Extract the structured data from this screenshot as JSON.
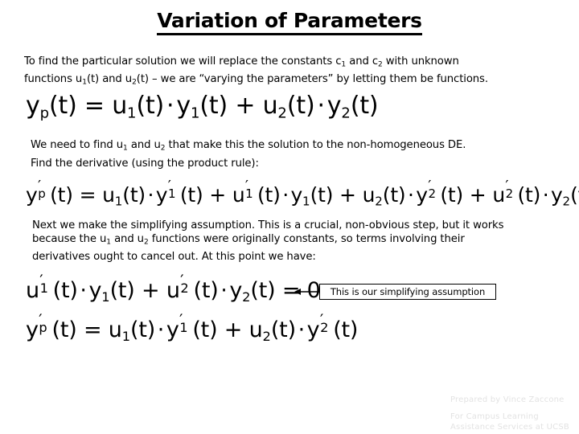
{
  "slide": {
    "title": "Variation of Parameters"
  },
  "body": {
    "intro_line1_a": "To find the particular solution we will replace the constants c",
    "intro_line1_sub1": "1",
    "intro_line1_b": " and c",
    "intro_line1_sub2": "2",
    "intro_line1_c": " with unknown",
    "intro_line2_a": "functions u",
    "intro_line2_sub1": "1",
    "intro_line2_b": "(t) and u",
    "intro_line2_sub2": "2",
    "intro_line2_c": "(t) – we are “varying the parameters” by letting them be functions.",
    "need_a": "We need to find u",
    "need_sub1": "1",
    "need_b": " and u",
    "need_sub2": "2",
    "need_c": " that make this the solution to the non-homogeneous DE.",
    "derivative_line": "Find the derivative (using the product rule):",
    "next_line1": "Next we make the simplifying assumption. This is a crucial, non-obvious step, but it works",
    "next_line2_a": "because the u",
    "next_line2_sub1": "1",
    "next_line2_b": " and u",
    "next_line2_sub2": "2",
    "next_line2_c": " functions were originally constants, so terms involving their",
    "next_line3": "derivatives ought to cancel out.  At this point we have:"
  },
  "equations": {
    "yp": {
      "lhs_var": "y",
      "lhs_sub": "p",
      "lhs_arg": "(t) = ",
      "t1_var": "u",
      "t1_sub": "1",
      "t1_arg": "(t)",
      "dot": "·",
      "t2_var": "y",
      "t2_sub": "1",
      "t2_arg": "(t)",
      "plus": " + ",
      "t3_var": "u",
      "t3_sub": "2",
      "t3_arg": "(t)",
      "t4_var": "y",
      "t4_sub": "2",
      "t4_arg": "(t)"
    },
    "yp_prime": {
      "lhs_var": "y",
      "lhs_prime": "′",
      "lhs_sub": "p",
      "lhs_arg": "(t) = ",
      "a_var": "u",
      "a_sub": "1",
      "a_arg": "(t)",
      "b_var": "y",
      "b_prime": "′",
      "b_sub": "1",
      "b_arg": "(t)",
      "c_var": "u",
      "c_prime": "′",
      "c_sub": "1",
      "c_arg": "(t)",
      "d_var": "y",
      "d_sub": "1",
      "d_arg": "(t)",
      "e_var": "u",
      "e_sub": "2",
      "e_arg": "(t)",
      "f_var": "y",
      "f_prime": "′",
      "f_sub": "2",
      "f_arg": "(t)",
      "g_var": "u",
      "g_prime": "′",
      "g_sub": "2",
      "g_arg": "(t)",
      "h_var": "y",
      "h_sub": "2",
      "h_arg": "(t)",
      "dot": "·",
      "plus": " + "
    },
    "assumption": {
      "a_var": "u",
      "a_prime": "′",
      "a_sub": "1",
      "a_arg": "(t)",
      "b_var": "y",
      "b_sub": "1",
      "b_arg": "(t)",
      "c_var": "u",
      "c_prime": "′",
      "c_sub": "2",
      "c_arg": "(t)",
      "d_var": "y",
      "d_sub": "2",
      "d_arg": "(t)",
      "dot": "·",
      "plus": " + ",
      "rhs": " = 0"
    },
    "final": {
      "lhs_var": "y",
      "lhs_prime": "′",
      "lhs_sub": "p",
      "lhs_arg": "(t) = ",
      "a_var": "u",
      "a_sub": "1",
      "a_arg": "(t)",
      "b_var": "y",
      "b_prime": "′",
      "b_sub": "1",
      "b_arg": "(t)",
      "c_var": "u",
      "c_sub": "2",
      "c_arg": "(t)",
      "d_var": "y",
      "d_prime": "′",
      "d_sub": "2",
      "d_arg": "(t)",
      "dot": "·",
      "plus": " + "
    }
  },
  "callout": {
    "text": "This is our simplifying assumption"
  },
  "footer": {
    "line1": "Prepared by Vince Zaccone",
    "line2": "For Campus Learning",
    "line3": "Assistance Services at UCSB"
  },
  "colors": {
    "text": "#000000",
    "background": "#ffffff",
    "footer_text": "#e3e3e3",
    "callout_border": "#000000"
  }
}
